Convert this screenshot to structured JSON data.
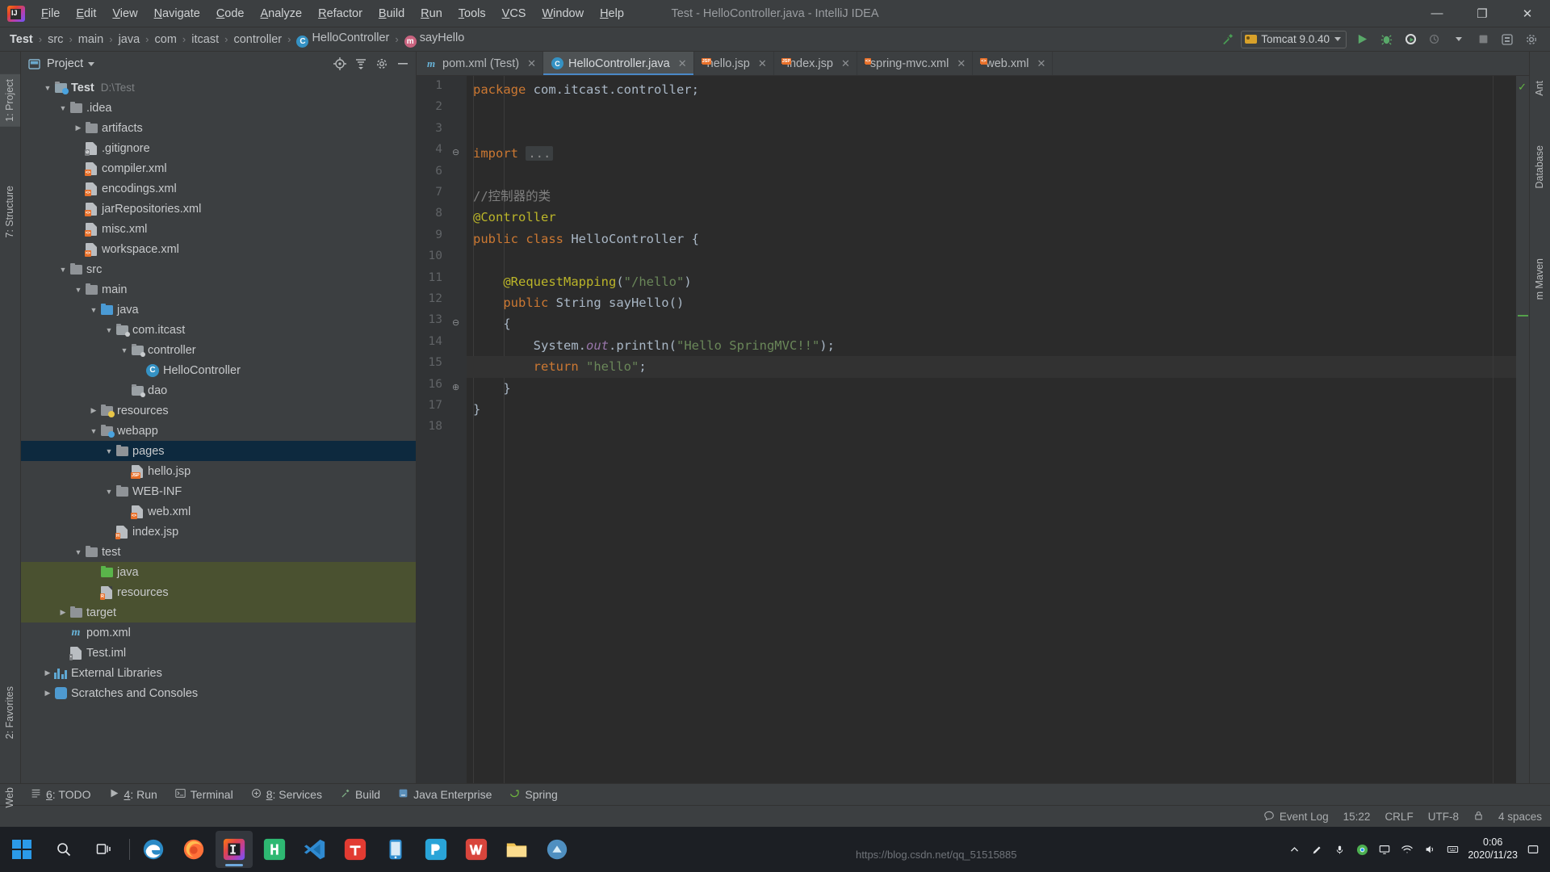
{
  "window": {
    "title": "Test - HelloController.java - IntelliJ IDEA",
    "minimize": "—",
    "maximize": "❐",
    "close": "✕"
  },
  "menu": {
    "items": [
      {
        "label": "File"
      },
      {
        "label": "Edit"
      },
      {
        "label": "View"
      },
      {
        "label": "Navigate"
      },
      {
        "label": "Code"
      },
      {
        "label": "Analyze"
      },
      {
        "label": "Refactor"
      },
      {
        "label": "Build"
      },
      {
        "label": "Run"
      },
      {
        "label": "Tools"
      },
      {
        "label": "VCS"
      },
      {
        "label": "Window"
      },
      {
        "label": "Help"
      }
    ]
  },
  "breadcrumb": {
    "separator": "›",
    "items": [
      {
        "label": "Test",
        "icon": null
      },
      {
        "label": "src",
        "icon": null
      },
      {
        "label": "main",
        "icon": null
      },
      {
        "label": "java",
        "icon": null
      },
      {
        "label": "com",
        "icon": null
      },
      {
        "label": "itcast",
        "icon": null
      },
      {
        "label": "controller",
        "icon": null
      },
      {
        "label": "HelloController",
        "icon": "class-icon",
        "glyph": "C"
      },
      {
        "label": "sayHello",
        "icon": "method-icon",
        "glyph": "m"
      }
    ]
  },
  "toolbar": {
    "build_hammer": "build-icon",
    "run_config": "Tomcat 9.0.40",
    "run": "run-icon",
    "debug": "debug-icon",
    "run_coverage": "run-with-coverage-icon",
    "profiler": "profiler-icon",
    "stop": "stop-icon",
    "search_everywhere": "search-icon",
    "settings": "settings-icon"
  },
  "left_strip": {
    "tabs": [
      {
        "label": "1: Project",
        "selected": true
      },
      {
        "label": "7: Structure",
        "selected": false
      },
      {
        "label": "2: Favorites",
        "selected": false
      },
      {
        "label": "Web",
        "selected": false
      }
    ]
  },
  "right_strip": {
    "tabs": [
      {
        "label": "Ant"
      },
      {
        "label": "Database"
      },
      {
        "label": "m  Maven"
      }
    ]
  },
  "project_panel": {
    "title": "Project",
    "title_caret": "▾",
    "icons": [
      "locate-icon",
      "collapse-all-icon",
      "settings-icon",
      "hide-icon"
    ],
    "tree": [
      {
        "indent": 0,
        "arrow": "▼",
        "icon": "module-folder",
        "label": "Test",
        "sub": "D:\\Test",
        "bold": true,
        "state": "normal"
      },
      {
        "indent": 1,
        "arrow": "▼",
        "icon": "folder",
        "label": ".idea",
        "sub": "",
        "bold": false,
        "state": "normal"
      },
      {
        "indent": 2,
        "arrow": "▶",
        "icon": "folder",
        "label": "artifacts",
        "sub": "",
        "bold": false,
        "state": "normal"
      },
      {
        "indent": 2,
        "arrow": "",
        "icon": "file-gitignore",
        "label": ".gitignore",
        "sub": "",
        "bold": false,
        "state": "normal"
      },
      {
        "indent": 2,
        "arrow": "",
        "icon": "file-xml",
        "label": "compiler.xml",
        "sub": "",
        "bold": false,
        "state": "normal"
      },
      {
        "indent": 2,
        "arrow": "",
        "icon": "file-xml",
        "label": "encodings.xml",
        "sub": "",
        "bold": false,
        "state": "normal"
      },
      {
        "indent": 2,
        "arrow": "",
        "icon": "file-xml",
        "label": "jarRepositories.xml",
        "sub": "",
        "bold": false,
        "state": "normal"
      },
      {
        "indent": 2,
        "arrow": "",
        "icon": "file-xml",
        "label": "misc.xml",
        "sub": "",
        "bold": false,
        "state": "normal"
      },
      {
        "indent": 2,
        "arrow": "",
        "icon": "file-xml",
        "label": "workspace.xml",
        "sub": "",
        "bold": false,
        "state": "normal"
      },
      {
        "indent": 1,
        "arrow": "▼",
        "icon": "folder",
        "label": "src",
        "sub": "",
        "bold": false,
        "state": "normal"
      },
      {
        "indent": 2,
        "arrow": "▼",
        "icon": "folder",
        "label": "main",
        "sub": "",
        "bold": false,
        "state": "normal"
      },
      {
        "indent": 3,
        "arrow": "▼",
        "icon": "source-folder",
        "label": "java",
        "sub": "",
        "bold": false,
        "state": "normal"
      },
      {
        "indent": 4,
        "arrow": "▼",
        "icon": "package",
        "label": "com.itcast",
        "sub": "",
        "bold": false,
        "state": "normal"
      },
      {
        "indent": 5,
        "arrow": "▼",
        "icon": "package",
        "label": "controller",
        "sub": "",
        "bold": false,
        "state": "normal"
      },
      {
        "indent": 6,
        "arrow": "",
        "icon": "java-class",
        "label": "HelloController",
        "sub": "",
        "bold": false,
        "state": "normal"
      },
      {
        "indent": 5,
        "arrow": "",
        "icon": "package",
        "label": "dao",
        "sub": "",
        "bold": false,
        "state": "normal"
      },
      {
        "indent": 3,
        "arrow": "▶",
        "icon": "resource-folder",
        "label": "resources",
        "sub": "",
        "bold": false,
        "state": "normal"
      },
      {
        "indent": 3,
        "arrow": "▼",
        "icon": "web-folder",
        "label": "webapp",
        "sub": "",
        "bold": false,
        "state": "normal"
      },
      {
        "indent": 4,
        "arrow": "▼",
        "icon": "folder",
        "label": "pages",
        "sub": "",
        "bold": false,
        "state": "selected"
      },
      {
        "indent": 5,
        "arrow": "",
        "icon": "file-jsp",
        "label": "hello.jsp",
        "sub": "",
        "bold": false,
        "state": "normal"
      },
      {
        "indent": 4,
        "arrow": "▼",
        "icon": "folder",
        "label": "WEB-INF",
        "sub": "",
        "bold": false,
        "state": "normal"
      },
      {
        "indent": 5,
        "arrow": "",
        "icon": "file-xml-web",
        "label": "web.xml",
        "sub": "",
        "bold": false,
        "state": "normal"
      },
      {
        "indent": 4,
        "arrow": "",
        "icon": "file-jsp-h",
        "label": "index.jsp",
        "sub": "",
        "bold": false,
        "state": "normal"
      },
      {
        "indent": 2,
        "arrow": "▼",
        "icon": "folder",
        "label": "test",
        "sub": "",
        "bold": false,
        "state": "normal"
      },
      {
        "indent": 3,
        "arrow": "",
        "icon": "test-source-folder",
        "label": "java",
        "sub": "",
        "bold": false,
        "state": "green"
      },
      {
        "indent": 3,
        "arrow": "",
        "icon": "test-resource-folder",
        "label": "resources",
        "sub": "",
        "bold": false,
        "state": "green"
      },
      {
        "indent": 1,
        "arrow": "▶",
        "icon": "folder",
        "label": "target",
        "sub": "",
        "bold": false,
        "state": "green"
      },
      {
        "indent": 1,
        "arrow": "",
        "icon": "maven",
        "label": "pom.xml",
        "sub": "",
        "bold": false,
        "state": "normal"
      },
      {
        "indent": 1,
        "arrow": "",
        "icon": "file-iml",
        "label": "Test.iml",
        "sub": "",
        "bold": false,
        "state": "normal"
      },
      {
        "indent": 0,
        "arrow": "▶",
        "icon": "libraries",
        "label": "External Libraries",
        "sub": "",
        "bold": false,
        "state": "normal"
      },
      {
        "indent": 0,
        "arrow": "▶",
        "icon": "scratches",
        "label": "Scratches and Consoles",
        "sub": "",
        "bold": false,
        "state": "normal"
      }
    ]
  },
  "editor": {
    "tabs": [
      {
        "label": "pom.xml (Test)",
        "icon": "maven-icon",
        "active": false,
        "close": "✕"
      },
      {
        "label": "HelloController.java",
        "icon": "class-icon",
        "active": true,
        "close": "✕"
      },
      {
        "label": "hello.jsp",
        "icon": "jsp-icon",
        "active": false,
        "close": "✕"
      },
      {
        "label": "index.jsp",
        "icon": "jsp-icon",
        "active": false,
        "close": "✕"
      },
      {
        "label": "spring-mvc.xml",
        "icon": "xml-icon",
        "active": false,
        "close": "✕"
      },
      {
        "label": "web.xml",
        "icon": "xml-icon",
        "active": false,
        "close": "✕"
      }
    ],
    "inspection_status": "✓",
    "lines": [
      {
        "num": "1",
        "marker": "",
        "fold": "",
        "current": false,
        "tokens": [
          {
            "t": "package ",
            "c": "kw"
          },
          {
            "t": "com.itcast.controller;",
            "c": "plain"
          }
        ]
      },
      {
        "num": "2",
        "marker": "",
        "fold": "",
        "current": false,
        "tokens": []
      },
      {
        "num": "3",
        "marker": "",
        "fold": "",
        "current": false,
        "tokens": []
      },
      {
        "num": "4",
        "marker": "",
        "fold": "⊖",
        "current": false,
        "tokens": [
          {
            "t": "import ",
            "c": "kw"
          },
          {
            "t": "...",
            "c": "foldbox"
          }
        ]
      },
      {
        "num": "6",
        "marker": "",
        "fold": "",
        "current": false,
        "tokens": []
      },
      {
        "num": "7",
        "marker": "",
        "fold": "",
        "current": false,
        "tokens": [
          {
            "t": "//控制器的类",
            "c": "cmt"
          }
        ]
      },
      {
        "num": "8",
        "marker": "",
        "fold": "",
        "current": false,
        "tokens": [
          {
            "t": "@Controller",
            "c": "ann"
          }
        ]
      },
      {
        "num": "9",
        "marker": "bean",
        "fold": "",
        "current": false,
        "tokens": [
          {
            "t": "public class ",
            "c": "kw"
          },
          {
            "t": "HelloController",
            "c": "plain"
          },
          {
            "t": " {",
            "c": "plain"
          }
        ]
      },
      {
        "num": "10",
        "marker": "",
        "fold": "",
        "current": false,
        "tokens": []
      },
      {
        "num": "11",
        "marker": "",
        "fold": "",
        "current": false,
        "tokens": [
          {
            "t": "    @RequestMapping",
            "c": "ann"
          },
          {
            "t": "(",
            "c": "plain"
          },
          {
            "t": "\"/hello\"",
            "c": "str"
          },
          {
            "t": ")",
            "c": "plain"
          }
        ]
      },
      {
        "num": "12",
        "marker": "bean",
        "fold": "",
        "current": false,
        "tokens": [
          {
            "t": "    ",
            "c": "plain"
          },
          {
            "t": "public ",
            "c": "kw"
          },
          {
            "t": "String ",
            "c": "plain"
          },
          {
            "t": "sayHello",
            "c": "plain"
          },
          {
            "t": "()",
            "c": "plain"
          }
        ]
      },
      {
        "num": "13",
        "marker": "",
        "fold": "⊖",
        "current": false,
        "tokens": [
          {
            "t": "    {",
            "c": "plain"
          }
        ]
      },
      {
        "num": "14",
        "marker": "",
        "fold": "",
        "current": false,
        "tokens": [
          {
            "t": "        System.",
            "c": "plain"
          },
          {
            "t": "out",
            "c": "stfield"
          },
          {
            "t": ".println(",
            "c": "plain"
          },
          {
            "t": "\"Hello SpringMVC!!\"",
            "c": "str"
          },
          {
            "t": ");",
            "c": "plain"
          }
        ]
      },
      {
        "num": "15",
        "marker": "",
        "fold": "",
        "current": true,
        "tokens": [
          {
            "t": "        ",
            "c": "plain"
          },
          {
            "t": "return ",
            "c": "kw"
          },
          {
            "t": "\"hello\"",
            "c": "str"
          },
          {
            "t": ";",
            "c": "plain"
          }
        ]
      },
      {
        "num": "16",
        "marker": "",
        "fold": "⊕",
        "current": false,
        "tokens": [
          {
            "t": "    }",
            "c": "plain"
          }
        ]
      },
      {
        "num": "17",
        "marker": "",
        "fold": "",
        "current": false,
        "tokens": [
          {
            "t": "}",
            "c": "plain"
          }
        ]
      },
      {
        "num": "18",
        "marker": "",
        "fold": "",
        "current": false,
        "tokens": []
      }
    ]
  },
  "bottom_tools": [
    {
      "icon": "todo-icon",
      "label": "6: TODO",
      "underline": "6"
    },
    {
      "icon": "run-icon",
      "label": "4: Run",
      "underline": "4"
    },
    {
      "icon": "terminal-icon",
      "label": "Terminal",
      "underline": ""
    },
    {
      "icon": "services-icon",
      "label": "8: Services",
      "underline": "8"
    },
    {
      "icon": "build-icon",
      "label": "Build",
      "underline": ""
    },
    {
      "icon": "java-enterprise-icon",
      "label": "Java Enterprise",
      "underline": ""
    },
    {
      "icon": "spring-icon",
      "label": "Spring",
      "underline": ""
    }
  ],
  "status_bar": {
    "event_log": "Event Log",
    "event_log_icon": "balloon-icon",
    "caret_position": "15:22",
    "line_separator": "CRLF",
    "encoding": "UTF-8",
    "lock_icon": "lock-icon",
    "indent": "4 spaces"
  },
  "taskbar": {
    "start": "windows-icon",
    "search": "search-icon",
    "task_view": "task-view-icon",
    "apps": [
      {
        "name": "edge-icon",
        "active": false
      },
      {
        "name": "firefox-icon",
        "active": false
      },
      {
        "name": "intellij-idea-icon",
        "active": true
      },
      {
        "name": "hbuilder-icon",
        "active": false
      },
      {
        "name": "vscode-icon",
        "active": false
      },
      {
        "name": "tim-icon",
        "active": false
      },
      {
        "name": "emulator-icon",
        "active": false
      },
      {
        "name": "photoshop-icon",
        "active": false
      },
      {
        "name": "wps-icon",
        "active": false
      },
      {
        "name": "file-explorer-icon",
        "active": false
      },
      {
        "name": "app-icon",
        "active": false
      }
    ],
    "tray": [
      "chevron-up-icon",
      "pen-icon",
      "mic-icon",
      "chrome-icon",
      "monitor-icon",
      "network-icon",
      "volume-icon",
      "ime-icon"
    ],
    "clock_time": "0:06",
    "clock_date": "2020/11/23",
    "watermark": "https://blog.csdn.net/qq_51515885"
  },
  "colors": {
    "bg": "#3c3f41",
    "editor_bg": "#2b2b2b",
    "selection": "#0d293e",
    "keyword": "#cc7832",
    "string": "#6a8759",
    "annotation": "#bbb529",
    "comment": "#808080",
    "accent": "#4a88c7"
  }
}
